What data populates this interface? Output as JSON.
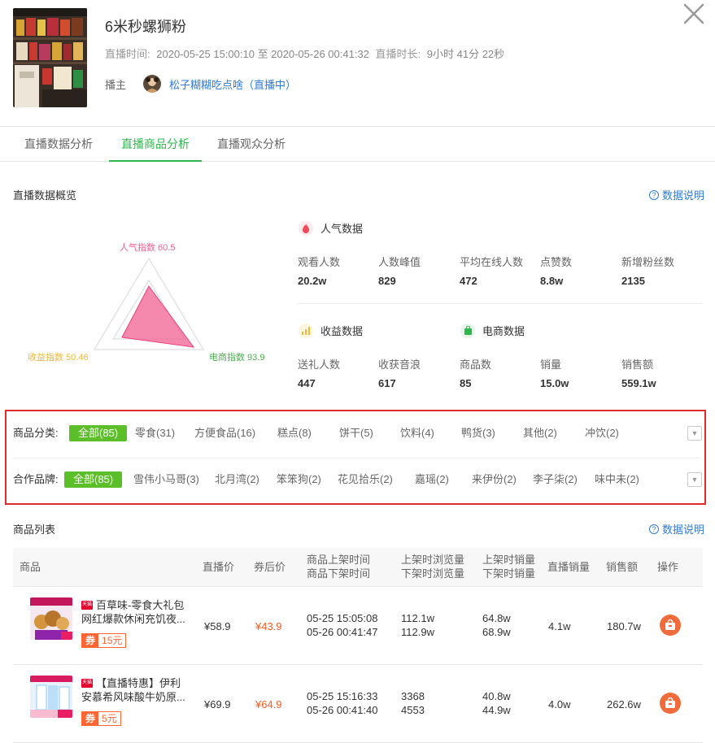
{
  "header": {
    "title": "6米秒螺狮粉",
    "time_label": "直播时间:",
    "time_value": "2020-05-25 15:00:10 至 2020-05-26 00:41:32",
    "duration_label": "直播时长:",
    "duration_value": "9小时 41分 22秒",
    "host_label": "播主",
    "host_name": "松子糊糊吃点啥（直播中）"
  },
  "tabs": [
    "直播数据分析",
    "直播商品分析",
    "直播观众分析"
  ],
  "active_tab": 1,
  "overview": {
    "title": "直播数据概览",
    "help": "数据说明",
    "radar": {
      "popularity": "人气指数 60.5",
      "revenue": "收益指数 50.46",
      "ecommerce": "电商指数 93.9"
    },
    "popularity_group": {
      "title": "人气数据",
      "stats": [
        {
          "label": "观看人数",
          "value": "20.2w"
        },
        {
          "label": "人数峰值",
          "value": "829"
        },
        {
          "label": "平均在线人数",
          "value": "472"
        },
        {
          "label": "点赞数",
          "value": "8.8w"
        },
        {
          "label": "新增粉丝数",
          "value": "2135"
        }
      ]
    },
    "revenue_group": {
      "title": "收益数据",
      "stats": [
        {
          "label": "送礼人数",
          "value": "447"
        },
        {
          "label": "收获音浪",
          "value": "617"
        }
      ]
    },
    "ecommerce_group": {
      "title": "电商数据",
      "stats": [
        {
          "label": "商品数",
          "value": "85"
        },
        {
          "label": "销量",
          "value": "15.0w"
        },
        {
          "label": "销售额",
          "value": "559.1w"
        }
      ]
    }
  },
  "filters": {
    "category_label": "商品分类:",
    "categories": [
      "全部(85)",
      "零食(31)",
      "方便食品(16)",
      "糕点(8)",
      "饼干(5)",
      "饮料(4)",
      "鸭货(3)",
      "其他(2)",
      "冲饮(2)"
    ],
    "brand_label": "合作品牌:",
    "brands": [
      "全部(85)",
      "雪伟小马哥(3)",
      "北月湾(2)",
      "笨笨狗(2)",
      "花见拾乐(2)",
      "嘉瑶(2)",
      "来伊份(2)",
      "李子柒(2)",
      "味中未(2)"
    ]
  },
  "product_list": {
    "title": "商品列表",
    "help": "数据说明",
    "columns": {
      "product": "商品",
      "live_price": "直播价",
      "coupon_price": "券后价",
      "on_time": "商品上架时间",
      "off_time": "商品下架时间",
      "on_views": "上架时浏览量",
      "off_views": "下架时浏览量",
      "on_sales": "上架时销量",
      "off_sales": "下架时销量",
      "live_sales": "直播销量",
      "revenue": "销售额",
      "action": "操作"
    },
    "rows": [
      {
        "name": "百草味-零食大礼包网红爆款休闲充饥夜...",
        "coupon_tag": "券",
        "coupon_value": "15元",
        "live_price": "¥58.9",
        "coupon_price": "¥43.9",
        "on_time": "05-25 15:05:08",
        "off_time": "05-26 00:41:47",
        "on_views": "112.1w",
        "off_views": "112.9w",
        "on_sales": "64.8w",
        "off_sales": "68.9w",
        "live_sales": "4.1w",
        "revenue": "180.7w"
      },
      {
        "name": "【直播特惠】伊利安慕希风味酸牛奶原...",
        "coupon_tag": "券",
        "coupon_value": "5元",
        "live_price": "¥69.9",
        "coupon_price": "¥64.9",
        "on_time": "05-25 15:16:33",
        "off_time": "05-26 00:41:40",
        "on_views": "3368",
        "off_views": "4553",
        "on_sales": "40.8w",
        "off_sales": "44.9w",
        "live_sales": "4.0w",
        "revenue": "262.6w"
      }
    ]
  },
  "colors": {
    "accent_green": "#2fb64d",
    "chip_green": "#5cbf2a",
    "link_blue": "#2e7bd6",
    "price_red": "#ff5a1f",
    "highlight_border": "#e02b2b",
    "radar_fill": "#f06292"
  }
}
